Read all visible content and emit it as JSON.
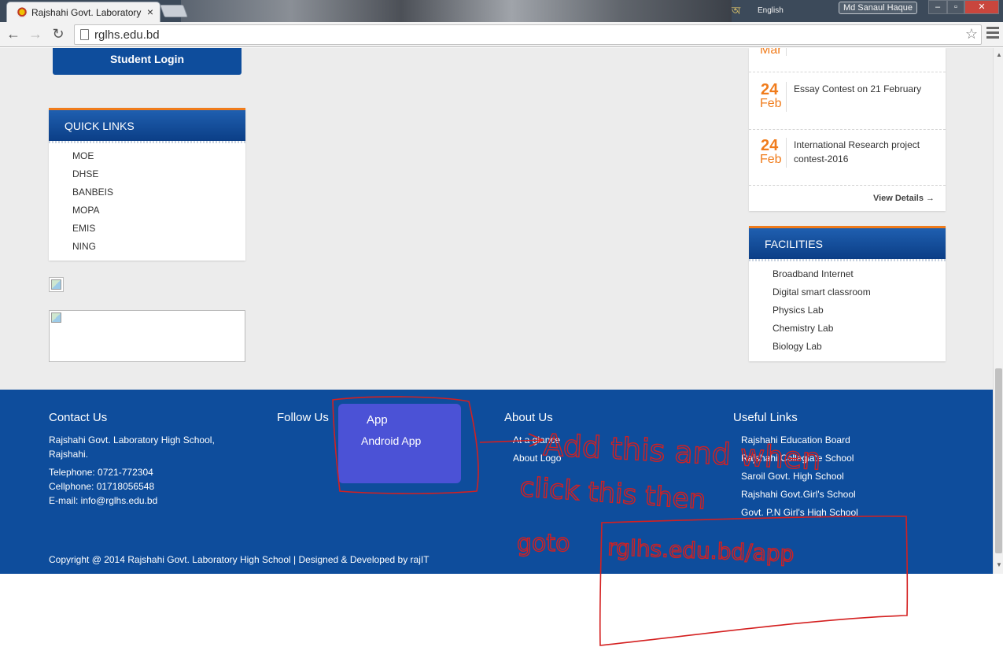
{
  "browser": {
    "tab_title": "Rajshahi Govt. Laboratory",
    "tab_close": "×",
    "url": "rglhs.edu.bd",
    "language": "English",
    "user_name": "Md Sanaul Haque",
    "back": "←",
    "forward": "→",
    "reload": "↻",
    "star": "☆",
    "win_min": "–",
    "win_max": "▫",
    "win_close": "✕"
  },
  "sidebar": {
    "login_label": "Student Login",
    "quick_links_title": "QUICK LINKS",
    "quick_links": [
      "MOE",
      "DHSE",
      "BANBEIS",
      "MOPA",
      "EMIS",
      "NING"
    ]
  },
  "notices": {
    "partial_month": "Mar",
    "items": [
      {
        "day": "24",
        "month": "Feb",
        "title": "Essay Contest on 21 February"
      },
      {
        "day": "24",
        "month": "Feb",
        "title": "International Research project contest-2016"
      }
    ],
    "view_details": "View Details →"
  },
  "facilities": {
    "title": "FACILITIES",
    "items": [
      "Broadband Internet",
      "Digital smart classroom",
      "Physics Lab",
      "Chemistry Lab",
      "Biology Lab"
    ]
  },
  "footer": {
    "contact": {
      "title": "Contact Us",
      "address_line1": "Rajshahi Govt. Laboratory High School,",
      "address_line2": "Rajshahi.",
      "telephone": "Telephone: 0721-772304",
      "cellphone": "Cellphone: 01718056548",
      "email": "E-mail: info@rglhs.edu.bd"
    },
    "follow_title": "Follow Us",
    "app": {
      "title": "App",
      "android": "Android App"
    },
    "about": {
      "title": "About Us",
      "links": [
        "At a glance",
        "About Logo"
      ]
    },
    "useful": {
      "title": "Useful Links",
      "links": [
        "Rajshahi Education Board",
        "Rajshahi Collegiate School",
        "Saroil Govt. High School",
        "Rajshahi Govt.Girl's School",
        "Govt. P.N Girl's High School"
      ]
    },
    "copyright": "Copyright @ 2014 Rajshahi Govt. Laboratory High School | Designed & Developed by rajIT"
  },
  "annotation": {
    "line1": "Add this and when",
    "line2": "click this then",
    "goto": "goto",
    "target_url": "rglhs.edu.bd/app",
    "color": "#d42020"
  },
  "colors": {
    "brand_blue": "#0e4d9c",
    "accent_orange": "#f07c1c",
    "app_block": "#4b52d6"
  }
}
